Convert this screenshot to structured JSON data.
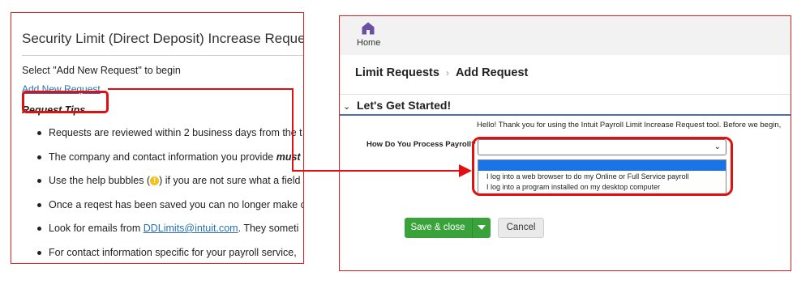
{
  "left": {
    "title": "Security Limit (Direct Deposit) Increase Request",
    "intro": "Select \"Add New Request\" to begin",
    "add_new_link": "Add New Request",
    "tips_heading": "Request Tips",
    "tips": [
      {
        "text": "Requests are reviewed within 2 business days from the t"
      },
      {
        "pre": "The company and contact information you provide ",
        "em": "must"
      },
      {
        "pre": "Use the help bubbles (",
        "post": ") if you are not sure what a field"
      },
      {
        "text": "Once a reqest has been saved you can no longer make ch"
      },
      {
        "pre": "Look for emails from ",
        "link": "DDLimits@intuit.com",
        "post": ". They someti"
      },
      {
        "text": "For contact information specific for your payroll service,"
      }
    ]
  },
  "right": {
    "home_label": "Home",
    "breadcrumb": [
      "Limit Requests",
      "Add Request"
    ],
    "section_title": "Let's Get Started!",
    "intro_text": "Hello! Thank you for using the Intuit Payroll Limit Increase Request tool. Before we begin,",
    "payroll_label": "How Do You Process Payroll?",
    "select_value": "",
    "options": [
      "",
      "I log into a web browser to do my Online or Full Service payroll",
      "I log into a program installed on my desktop computer"
    ],
    "save_label": "Save & close",
    "cancel_label": "Cancel"
  },
  "colors": {
    "highlight": "#e01010",
    "save_green": "#3aa23a",
    "link_blue": "#2a6fb5",
    "home_purple": "#6b4fa0",
    "section_rule": "#4a6fb3",
    "option_selected": "#1a73e8"
  },
  "icons": {
    "home": "home-icon",
    "breadcrumb_sep": "chevron-right-icon",
    "section": "chevron-down-icon",
    "select": "chevron-down-icon",
    "save_menu": "caret-down-icon",
    "help": "help-bubble-icon"
  }
}
